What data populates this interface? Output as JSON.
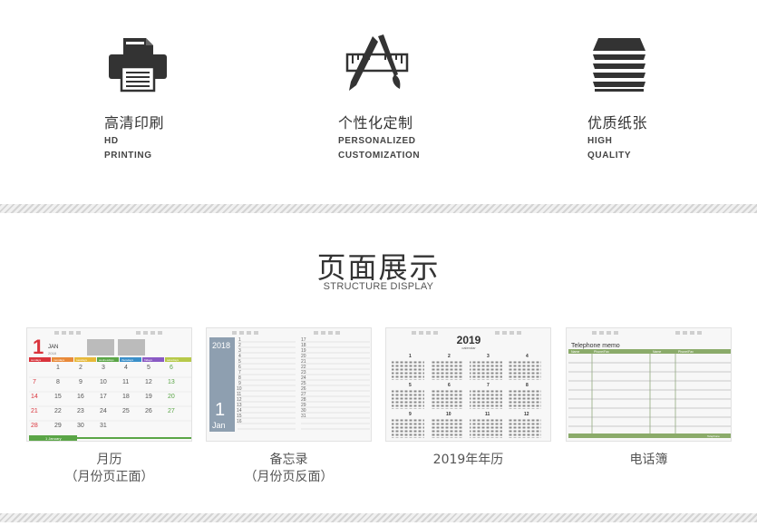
{
  "features": [
    {
      "title": "高清印刷",
      "line1": "HD",
      "line2": "PRINTING",
      "icon": "printer-icon"
    },
    {
      "title": "个性化定制",
      "line1": "PERSONALIZED",
      "line2": "CUSTOMIZATION",
      "icon": "ruler-pencil-brush-icon"
    },
    {
      "title": "优质纸张",
      "line1": "HIGH",
      "line2": "QUALITY",
      "icon": "paper-stack-icon"
    }
  ],
  "section": {
    "title": "页面展示",
    "subtitle": "STRUCTURE DISPLAY"
  },
  "displays": [
    {
      "caption1": "月历",
      "caption2": "（月份页正面）",
      "month_num": "1",
      "month_name": "JAN",
      "year": "2018",
      "weekdays": [
        "sundays",
        "mondays",
        "tuesdays",
        "wednesdays",
        "thursdays",
        "fridays",
        "saturdays"
      ],
      "footer": "1 January"
    },
    {
      "caption1": "备忘录",
      "caption2": "（月份页反面）",
      "year": "2018",
      "month_num": "1",
      "month_name": "Jan"
    },
    {
      "caption1": "2019年年历",
      "year": "2019",
      "label": "calendar",
      "months": [
        "1",
        "2",
        "3",
        "4",
        "5",
        "6",
        "7",
        "8",
        "9",
        "10",
        "11",
        "12"
      ]
    },
    {
      "caption1": "电话簿",
      "title": "Telephone memo",
      "col1": "Name",
      "col2": "Phone/Fax",
      "col3": "Name",
      "col4": "Phone/Fax",
      "footer": "Telephone"
    }
  ],
  "colors": {
    "red": "#d9343c",
    "green": "#5aa546",
    "slate": "#8e9fb0",
    "olive": "#8bab6a",
    "stripe": "#d4d4d4"
  }
}
